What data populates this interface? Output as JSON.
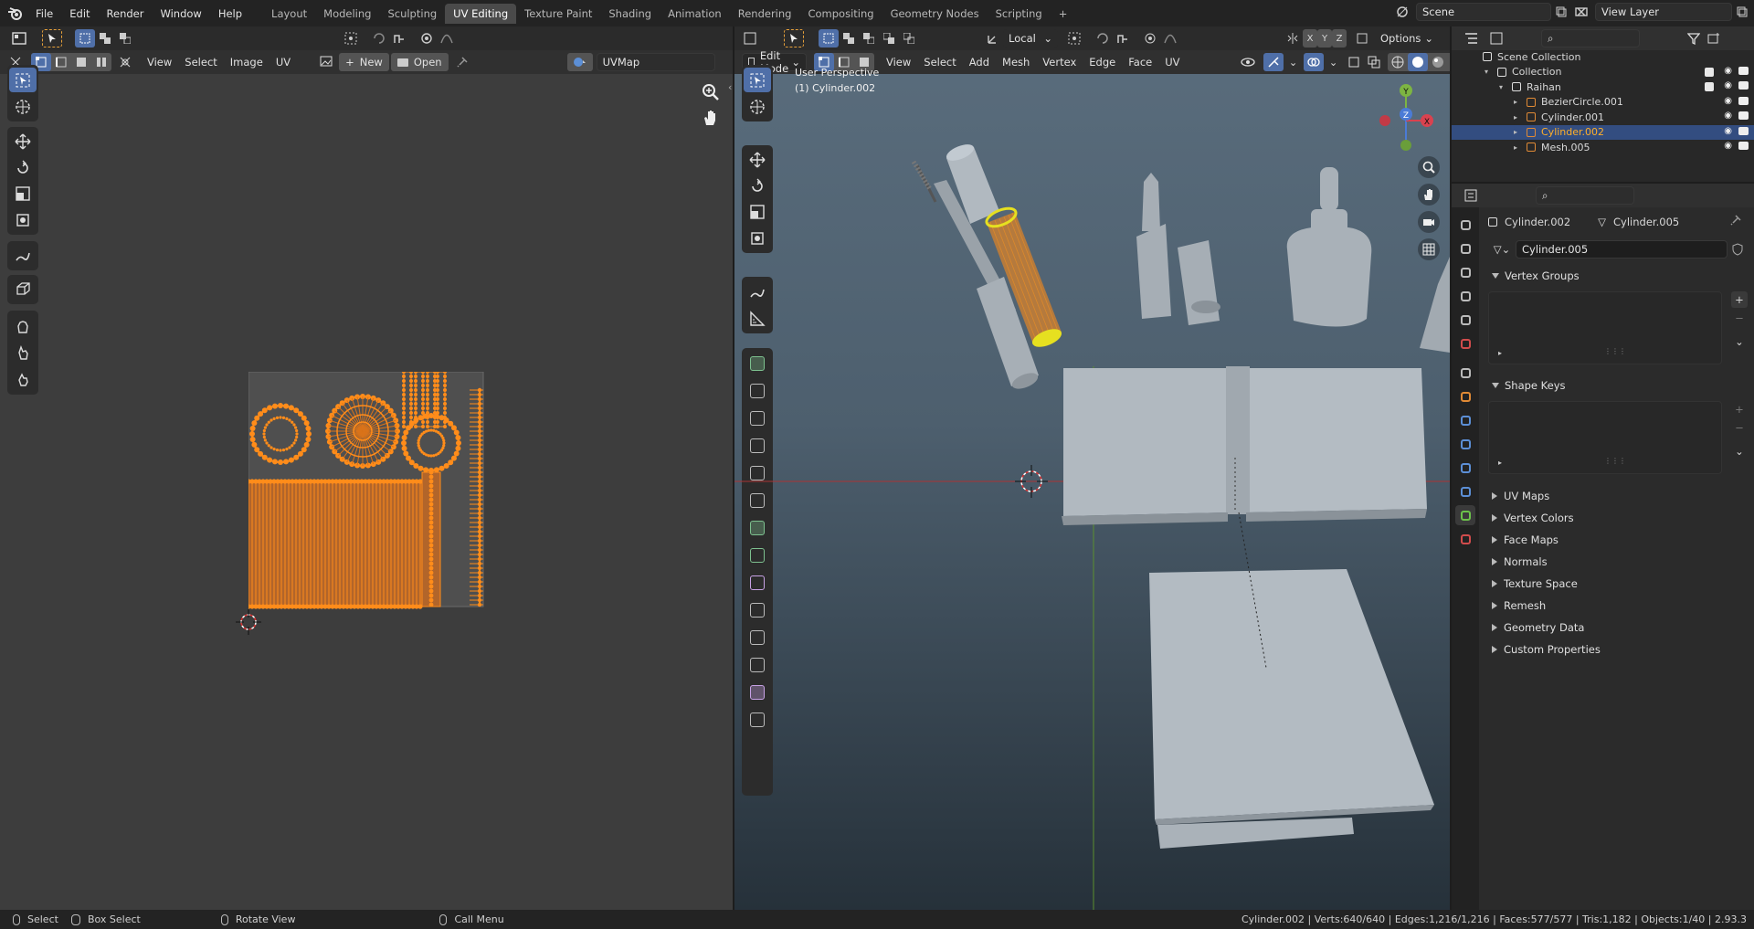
{
  "topbar": {
    "menus": [
      "File",
      "Edit",
      "Render",
      "Window",
      "Help"
    ],
    "tabs": [
      "Layout",
      "Modeling",
      "Sculpting",
      "UV Editing",
      "Texture Paint",
      "Shading",
      "Animation",
      "Rendering",
      "Compositing",
      "Geometry Nodes",
      "Scripting"
    ],
    "active_tab": "UV Editing",
    "scene": "Scene",
    "view_layer": "View Layer",
    "add_tab": "+"
  },
  "uv_editor": {
    "header": {
      "view": "View",
      "select": "Select",
      "image": "Image",
      "uv": "UV",
      "new": "New",
      "open": "Open",
      "uvmap": "UVMap"
    }
  },
  "viewport": {
    "mode": "Edit Mode",
    "orientation": "Local",
    "options": "Options",
    "menus": [
      "View",
      "Select",
      "Add",
      "Mesh",
      "Vertex",
      "Edge",
      "Face",
      "UV"
    ],
    "overlay_text_1": "User Perspective",
    "overlay_text_2": "(1) Cylinder.002",
    "gizmo": {
      "x": "X",
      "y": "Y",
      "z": "Z"
    }
  },
  "outliner": {
    "search_placeholder": "",
    "rows": [
      {
        "label": "Scene Collection",
        "indent": 0
      },
      {
        "label": "Collection",
        "indent": 1
      },
      {
        "label": "Raihan",
        "indent": 2
      },
      {
        "label": "BezierCircle.001",
        "indent": 3
      },
      {
        "label": "Cylinder.001",
        "indent": 3
      },
      {
        "label": "Cylinder.002",
        "indent": 3,
        "selected": true
      },
      {
        "label": "Mesh.005",
        "indent": 3
      }
    ]
  },
  "properties": {
    "object": "Cylinder.002",
    "mesh": "Cylinder.005",
    "data_name": "Cylinder.005",
    "open_panels": [
      "Vertex Groups",
      "Shape Keys"
    ],
    "closed_panels": [
      "UV Maps",
      "Vertex Colors",
      "Face Maps",
      "Normals",
      "Texture Space",
      "Remesh",
      "Geometry Data",
      "Custom Properties"
    ]
  },
  "status": {
    "select": "Select",
    "box_select": "Box Select",
    "rotate": "Rotate View",
    "call_menu": "Call Menu",
    "stats": "Cylinder.002 | Verts:640/640 | Edges:1,216/1,216 | Faces:577/577 | Tris:1,182 | Objects:1/40 | 2.93.3"
  },
  "colors": {
    "accent": "#4f6fa8",
    "selected": "#ff8c1a",
    "bg": "#3d3d3d"
  }
}
